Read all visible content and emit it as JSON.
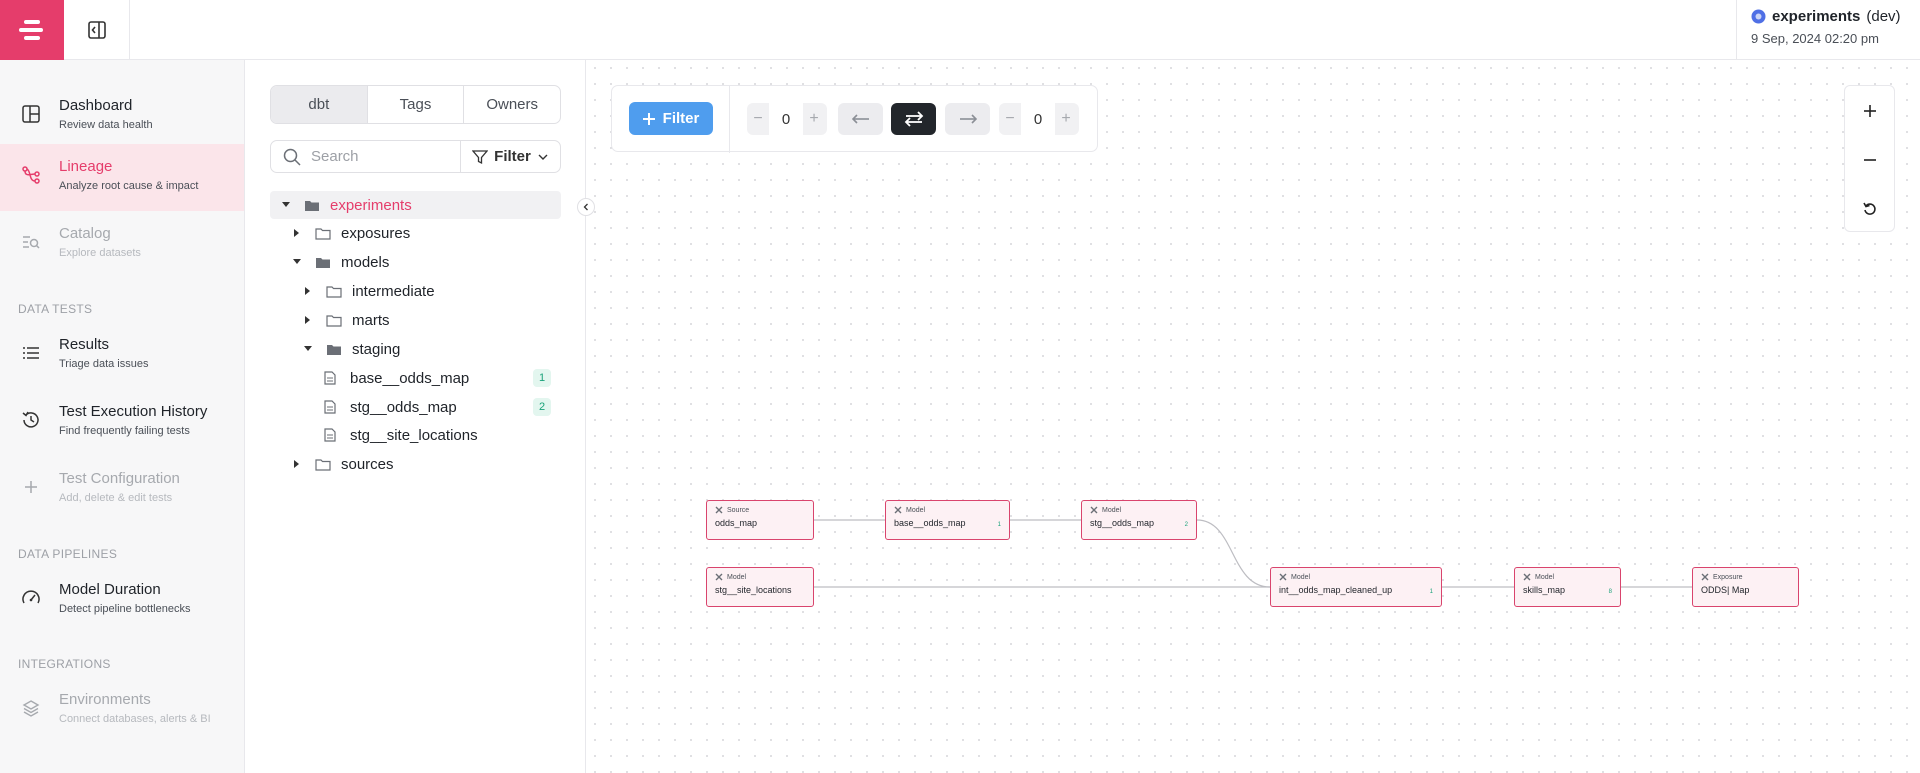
{
  "environment": {
    "project": "experiments",
    "env": "(dev)",
    "timestamp": "9 Sep, 2024 02:20 pm"
  },
  "sidebar": {
    "items": [
      {
        "title": "Dashboard",
        "subtitle": "Review data health"
      },
      {
        "title": "Lineage",
        "subtitle": "Analyze root cause & impact"
      },
      {
        "title": "Catalog",
        "subtitle": "Explore datasets"
      },
      {
        "title": "Results",
        "subtitle": "Triage data issues"
      },
      {
        "title": "Test Execution History",
        "subtitle": "Find frequently failing tests"
      },
      {
        "title": "Test Configuration",
        "subtitle": "Add, delete & edit tests"
      },
      {
        "title": "Model Duration",
        "subtitle": "Detect pipeline bottlenecks"
      },
      {
        "title": "Environments",
        "subtitle": "Connect databases, alerts & BI"
      }
    ],
    "sections": [
      "DATA TESTS",
      "DATA PIPELINES",
      "INTEGRATIONS"
    ]
  },
  "tree_panel": {
    "tabs": [
      "dbt",
      "Tags",
      "Owners"
    ],
    "search_placeholder": "Search",
    "filter_label": "Filter",
    "nodes": [
      {
        "label": "experiments"
      },
      {
        "label": "exposures"
      },
      {
        "label": "models"
      },
      {
        "label": "intermediate"
      },
      {
        "label": "marts"
      },
      {
        "label": "staging"
      },
      {
        "label": "base__odds_map",
        "badge": "1"
      },
      {
        "label": "stg__odds_map",
        "badge": "2"
      },
      {
        "label": "stg__site_locations"
      },
      {
        "label": "sources"
      }
    ]
  },
  "toolbar": {
    "filter_label": "Filter",
    "upstream_depth": "0",
    "downstream_depth": "0"
  },
  "graph": {
    "nodes": [
      {
        "type": "Source",
        "name": "odds_map"
      },
      {
        "type": "Model",
        "name": "base__odds_map",
        "badge": "1"
      },
      {
        "type": "Model",
        "name": "stg__odds_map",
        "badge": "2"
      },
      {
        "type": "Model",
        "name": "stg__site_locations"
      },
      {
        "type": "Model",
        "name": "int__odds_map_cleaned_up",
        "badge": "1"
      },
      {
        "type": "Model",
        "name": "skills_map",
        "badge": "8"
      },
      {
        "type": "Exposure",
        "name": "ODDS| Map"
      }
    ]
  },
  "colors": {
    "brand": "#e53d6b",
    "primary_button": "#4f9dee",
    "success": "#1aa27a"
  }
}
